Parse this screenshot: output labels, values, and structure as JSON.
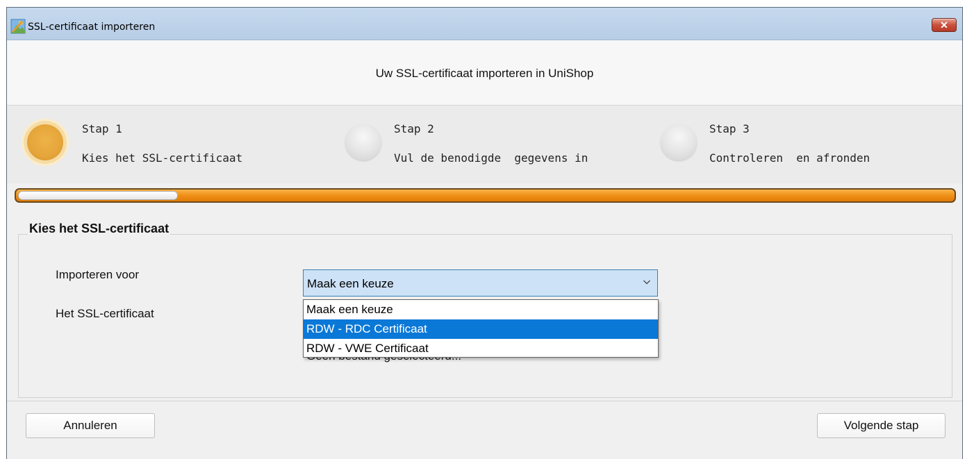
{
  "window": {
    "title": "SSL-certificaat importeren",
    "close_glyph": "✕"
  },
  "header": {
    "title": "Uw SSL-certificaat importeren in UniShop"
  },
  "steps": [
    {
      "label": "Stap 1",
      "description": "Kies het SSL-certificaat",
      "state": "active"
    },
    {
      "label": "Stap 2",
      "description": "Vul de benodigde  gegevens in",
      "state": "inactive"
    },
    {
      "label": "Stap 3",
      "description": "Controleren  en afronden",
      "state": "inactive"
    }
  ],
  "progress": {
    "fraction": 0.17,
    "color": "#ee8d14"
  },
  "section": {
    "title": "Kies het SSL-certificaat",
    "import_for_label": "Importeren voor",
    "certificate_label": "Het SSL-certificaat",
    "certificate_value_partial": "Geen bestand geselecteerd..."
  },
  "combo": {
    "selected_value": "Maak een keuze",
    "icon": "chevron-down-icon",
    "options": [
      {
        "label": "Maak een keuze",
        "highlighted": false
      },
      {
        "label": "RDW - RDC Certificaat",
        "highlighted": true
      },
      {
        "label": "RDW - VWE Certificaat",
        "highlighted": false
      }
    ]
  },
  "footer": {
    "cancel_label": "Annuleren",
    "next_label": "Volgende stap"
  },
  "colors": {
    "highlight": "#0a78d7",
    "active_step": "#e5a53a",
    "close_button": "#c9503c"
  }
}
